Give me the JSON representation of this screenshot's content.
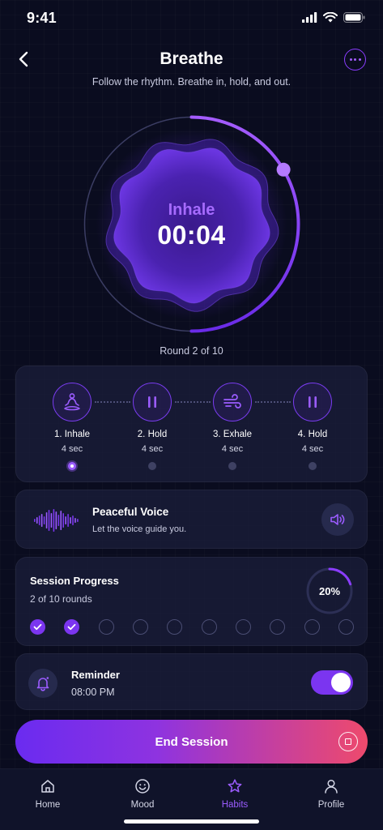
{
  "status_bar": {
    "time": "9:41"
  },
  "header": {
    "title": "Breathe",
    "subtitle": "Follow the rhythm. Breathe in, hold, and out."
  },
  "breath": {
    "phase": "Inhale",
    "timer": "00:04",
    "round_text": "Round 2 of 10",
    "ring_progress": 0.5
  },
  "steps": [
    {
      "name": "1. Inhale",
      "duration": "4 sec",
      "icon": "meditation-icon",
      "active": true
    },
    {
      "name": "2. Hold",
      "duration": "4 sec",
      "icon": "pause-icon",
      "active": false
    },
    {
      "name": "3. Exhale",
      "duration": "4 sec",
      "icon": "wind-icon",
      "active": false
    },
    {
      "name": "4. Hold",
      "duration": "4 sec",
      "icon": "pause-icon",
      "active": false
    }
  ],
  "voice": {
    "title": "Peaceful Voice",
    "subtitle": "Let the voice guide you.",
    "icon": "speaker-icon"
  },
  "progress": {
    "title": "Session Progress",
    "subtitle": "2 of 10 rounds",
    "percent_label": "20%",
    "fraction": 0.2,
    "completed_rounds": 2,
    "total_rounds": 10
  },
  "reminder": {
    "title": "Reminder",
    "time": "08:00 PM",
    "enabled": true
  },
  "end_button": {
    "label": "End Session"
  },
  "tabs": [
    {
      "label": "Home",
      "icon": "home-icon",
      "active": false
    },
    {
      "label": "Mood",
      "icon": "smile-icon",
      "active": false
    },
    {
      "label": "Habits",
      "icon": "star-icon",
      "active": true
    },
    {
      "label": "Profile",
      "icon": "user-icon",
      "active": false
    }
  ],
  "colors": {
    "accent": "#7b35f0",
    "accent_light": "#9b5cff",
    "background": "#0a0c1f",
    "card": "#1a1d3a",
    "gradient_end": "#ee4a6c"
  }
}
